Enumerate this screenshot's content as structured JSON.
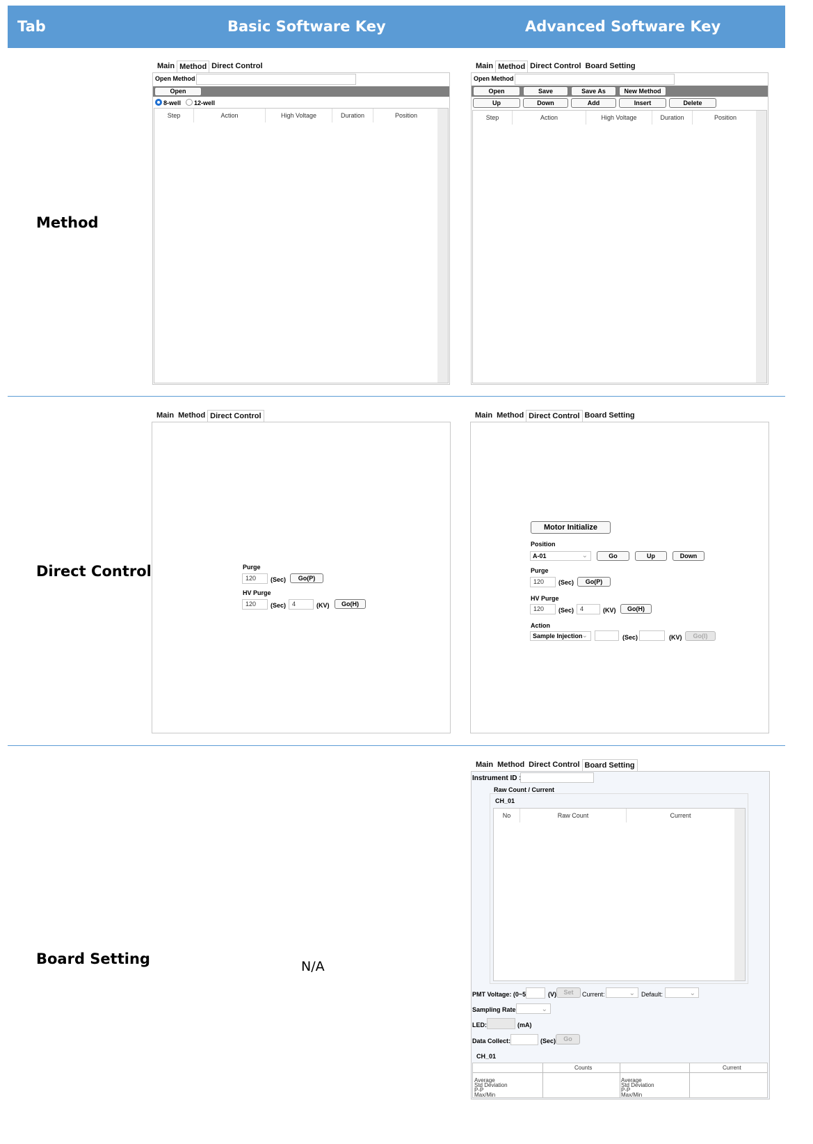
{
  "header": {
    "col1": "Tab",
    "col2": "Basic Software Key",
    "col3": "Advanced Software Key"
  },
  "rows": {
    "method": "Method",
    "direct": "Direct Control",
    "board": "Board Setting",
    "board_basic": "N/A"
  },
  "colors": {
    "header_bg": "#5b9bd5",
    "bar": "#7f7f7f",
    "radio": "#1e6fd1"
  },
  "tabs": {
    "main": "Main",
    "method": "Method",
    "direct": "Direct Control",
    "board": "Board Setting"
  },
  "method": {
    "open_method_label": "Open Method :",
    "open": "Open",
    "save": "Save",
    "save_as": "Save As",
    "new_method": "New Method",
    "up": "Up",
    "down": "Down",
    "add": "Add",
    "insert": "Insert",
    "delete": "Delete",
    "well8": "8-well",
    "well12": "12-well",
    "columns": [
      "Step",
      "Action",
      "High Voltage",
      "Duration",
      "Position"
    ]
  },
  "direct": {
    "motor_init": "Motor Initialize",
    "position": "Position",
    "position_value": "A-01",
    "go": "Go",
    "up": "Up",
    "down": "Down",
    "purge": "Purge",
    "purge_value": "120",
    "sec": "(Sec)",
    "go_p": "Go(P)",
    "hv_purge": "HV Purge",
    "hv_sec_value": "120",
    "hv_kv_value": "4",
    "kv": "(KV)",
    "go_h": "Go(H)",
    "action": "Action",
    "action_value": "Sample Injection",
    "go_i": "Go(I)"
  },
  "board": {
    "instrument_id": "Instrument ID :",
    "group": "Raw Count / Current",
    "ch": "CH_01",
    "columns": [
      "No",
      "Raw Count",
      "Current"
    ],
    "pmt": "PMT Voltage: (0~5)",
    "v": "(V)",
    "set": "Set",
    "current": "Current:",
    "default": "Default:",
    "sampling": "Sampling Rate:",
    "led": "LED:",
    "ma": "(mA)",
    "data_collect": "Data Collect:",
    "sec": "(Sec)",
    "go": "Go",
    "ch2": "CH_01",
    "counts": "Counts",
    "current_col": "Current",
    "stats": [
      "Average",
      "Std Deviation",
      "P-P",
      "Max/Min"
    ]
  }
}
